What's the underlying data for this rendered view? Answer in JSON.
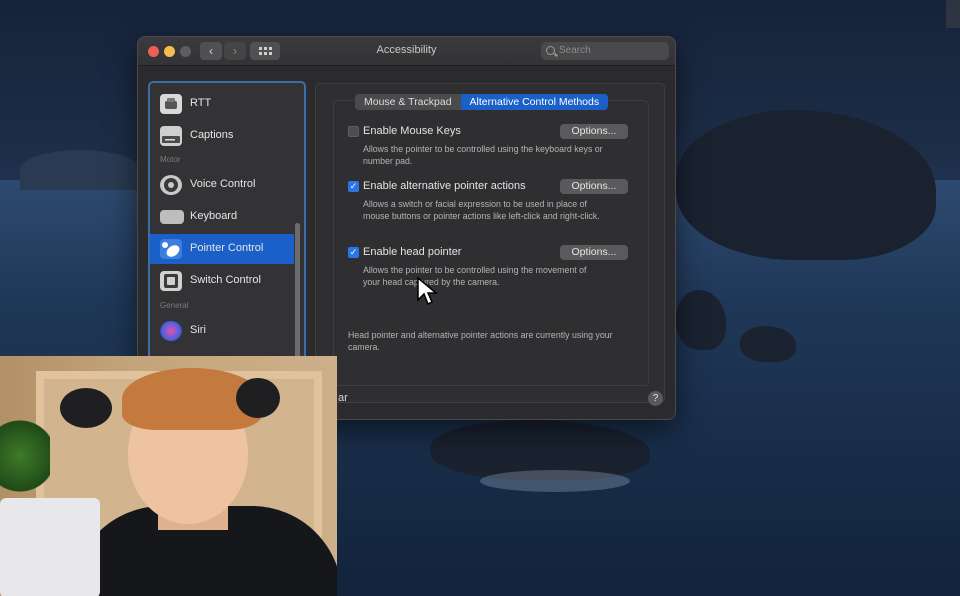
{
  "window": {
    "title": "Accessibility",
    "search_placeholder": "Search",
    "nav_back": "‹",
    "nav_forward": "›"
  },
  "sidebar": {
    "items": [
      {
        "label": "RTT",
        "icon": "rtt-icon"
      },
      {
        "label": "Captions",
        "icon": "captions-icon"
      },
      {
        "section": "Motor"
      },
      {
        "label": "Voice Control",
        "icon": "voice-control-icon"
      },
      {
        "label": "Keyboard",
        "icon": "keyboard-icon"
      },
      {
        "label": "Pointer Control",
        "icon": "pointer-control-icon",
        "selected": true
      },
      {
        "label": "Switch Control",
        "icon": "switch-control-icon"
      },
      {
        "section": "General"
      },
      {
        "label": "Siri",
        "icon": "siri-icon"
      }
    ]
  },
  "tabs": [
    {
      "label": "Mouse & Trackpad",
      "active": false
    },
    {
      "label": "Alternative Control Methods",
      "active": true
    }
  ],
  "options": [
    {
      "label": "Enable Mouse Keys",
      "checked": false,
      "button": "Options...",
      "desc": "Allows the pointer to be controlled using the keyboard keys or number pad."
    },
    {
      "label": "Enable alternative pointer actions",
      "checked": true,
      "button": "Options...",
      "desc": "Allows a switch or facial expression to be used in place of mouse buttons or pointer actions like left-click and right-click."
    },
    {
      "label": "Enable head pointer",
      "checked": true,
      "button": "Options...",
      "desc": "Allows the pointer to be controlled using the movement of your head captured by the camera."
    }
  ],
  "note": "Head pointer and alternative pointer actions are currently using your camera.",
  "bottom_text": "ar",
  "help": "?",
  "colors": {
    "accent": "#1b5fc9",
    "checkbox": "#2a76e5"
  }
}
